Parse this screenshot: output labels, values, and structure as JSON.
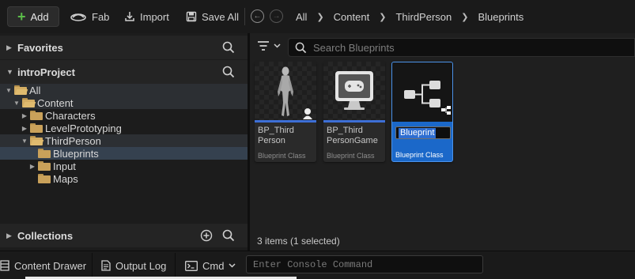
{
  "toolbar": {
    "add_label": "Add",
    "fab_label": "Fab",
    "import_label": "Import",
    "save_all_label": "Save All"
  },
  "breadcrumb": [
    "All",
    "Content",
    "ThirdPerson",
    "Blueprints"
  ],
  "sidebar": {
    "favorites_label": "Favorites",
    "project_label": "introProject",
    "collections_label": "Collections",
    "tree": [
      {
        "label": "All",
        "depth": 0,
        "expanded": true
      },
      {
        "label": "Content",
        "depth": 1,
        "expanded": true
      },
      {
        "label": "Characters",
        "depth": 2,
        "expanded": false
      },
      {
        "label": "LevelPrototyping",
        "depth": 2,
        "expanded": false
      },
      {
        "label": "ThirdPerson",
        "depth": 2,
        "expanded": true
      },
      {
        "label": "Blueprints",
        "depth": 3,
        "expanded": false,
        "selected": true
      },
      {
        "label": "Input",
        "depth": 3,
        "expanded": false
      },
      {
        "label": "Maps",
        "depth": 3,
        "expanded": false
      }
    ]
  },
  "content": {
    "search_placeholder": "Search Blueprints",
    "assets": [
      {
        "name": "BP_Third Person",
        "class_label": "Blueprint Class",
        "thumbnail": "character-mannequin-icon"
      },
      {
        "name": "BP_Third PersonGame",
        "class_label": "Blueprint Class",
        "thumbnail": "game-monitor-icon"
      },
      {
        "name": "Blueprint",
        "class_label": "Blueprint Class",
        "thumbnail": "blueprint-graph-icon",
        "renaming": true
      }
    ],
    "status": "3 items (1 selected)"
  },
  "bottom_bar": {
    "content_drawer_label": "Content Drawer",
    "output_log_label": "Output Log",
    "cmd_label": "Cmd",
    "console_placeholder": "Enter Console Command"
  },
  "colors": {
    "accent_blue": "#1b68c9",
    "folder": "#c9a15a",
    "add_plus": "#5bbd49"
  }
}
